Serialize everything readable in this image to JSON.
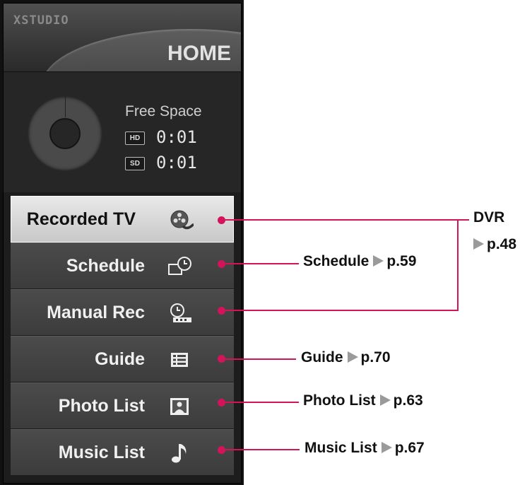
{
  "panel": {
    "brand": "XSTUDIO",
    "title": "HOME",
    "free_space": {
      "label": "Free Space",
      "hd_badge": "HD",
      "hd_time": "0:01",
      "sd_badge": "SD",
      "sd_time": "0:01"
    },
    "menu": [
      {
        "label": "Recorded TV",
        "icon": "film-reel-icon",
        "selected": true
      },
      {
        "label": "Schedule",
        "icon": "schedule-clock-icon",
        "selected": false
      },
      {
        "label": "Manual Rec",
        "icon": "manual-rec-icon",
        "selected": false
      },
      {
        "label": "Guide",
        "icon": "guide-list-icon",
        "selected": false
      },
      {
        "label": "Photo List",
        "icon": "photo-icon",
        "selected": false
      },
      {
        "label": "Music List",
        "icon": "music-note-icon",
        "selected": false
      }
    ]
  },
  "callouts": {
    "dvr": {
      "label": "DVR",
      "page": "p.48"
    },
    "schedule": {
      "label": "Schedule",
      "page": "p.59"
    },
    "guide": {
      "label": "Guide",
      "page": "p.70"
    },
    "photo": {
      "label": "Photo List",
      "page": "p.63"
    },
    "music": {
      "label": "Music List",
      "page": "p.67"
    }
  },
  "colors": {
    "accent_line": "#d4145a",
    "arrow": "#9a9a9a"
  }
}
